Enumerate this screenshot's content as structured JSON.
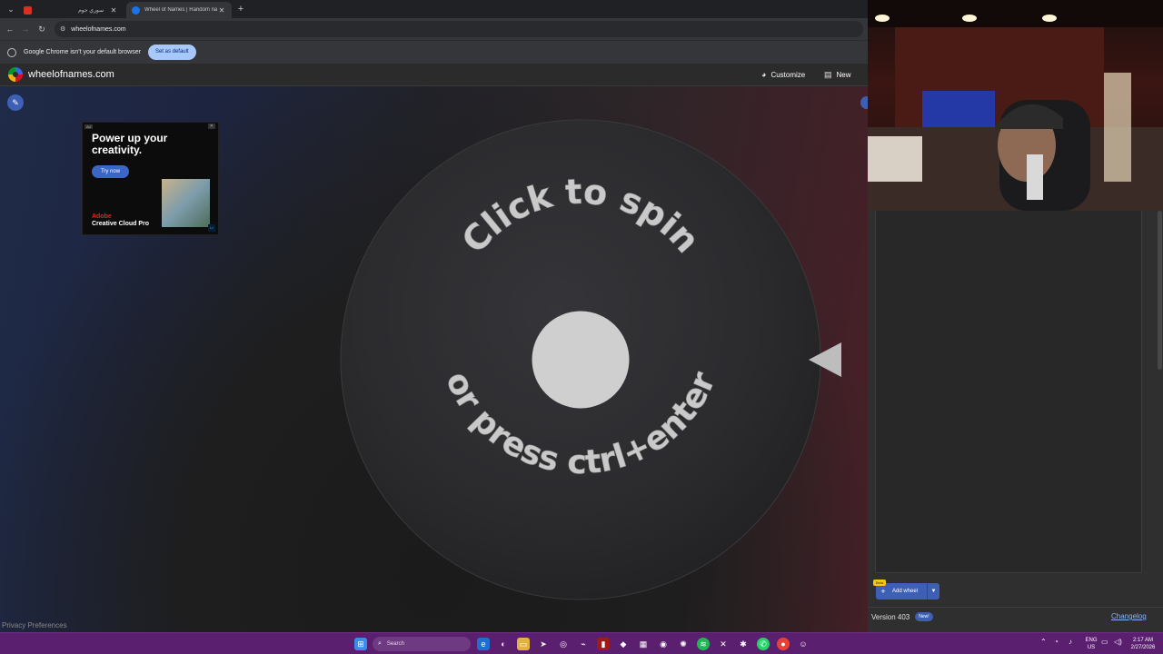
{
  "browser": {
    "tabs": [
      {
        "title": "سوري جوم",
        "favicon_color": "#d93025"
      },
      {
        "title": "Wheel of Names | Random nam",
        "favicon_color": "#1a73e8"
      }
    ],
    "url": "wheelofnames.com",
    "infobar": {
      "message": "Google Chrome isn't your default browser",
      "button": "Set as default"
    }
  },
  "site": {
    "name": "wheelofnames.com",
    "header_items": [
      {
        "label": "Customize",
        "icon": "palette-icon"
      },
      {
        "label": "New",
        "icon": "file-icon"
      }
    ]
  },
  "ad": {
    "tag": "Ad",
    "close": "✕",
    "headline": "Power up your creativity.",
    "cta": "Try now",
    "brand_line1": "Adobe",
    "brand_line2": "Creative Cloud Pro",
    "product_badge": "Lr"
  },
  "wheel": {
    "top_text": "Click to spin",
    "bottom_text": "or press ctrl+enter"
  },
  "privacy": "Privacy Preferences",
  "panel": {
    "beta_label": "Beta",
    "add_wheel": "Add wheel",
    "version": "Version 403",
    "new_badge": "New!",
    "changelog": "Changelog"
  },
  "taskbar": {
    "search": "Search",
    "lang_top": "ENG",
    "lang_bottom": "US",
    "time": "2:17 AM",
    "date": "2/27/2026"
  }
}
